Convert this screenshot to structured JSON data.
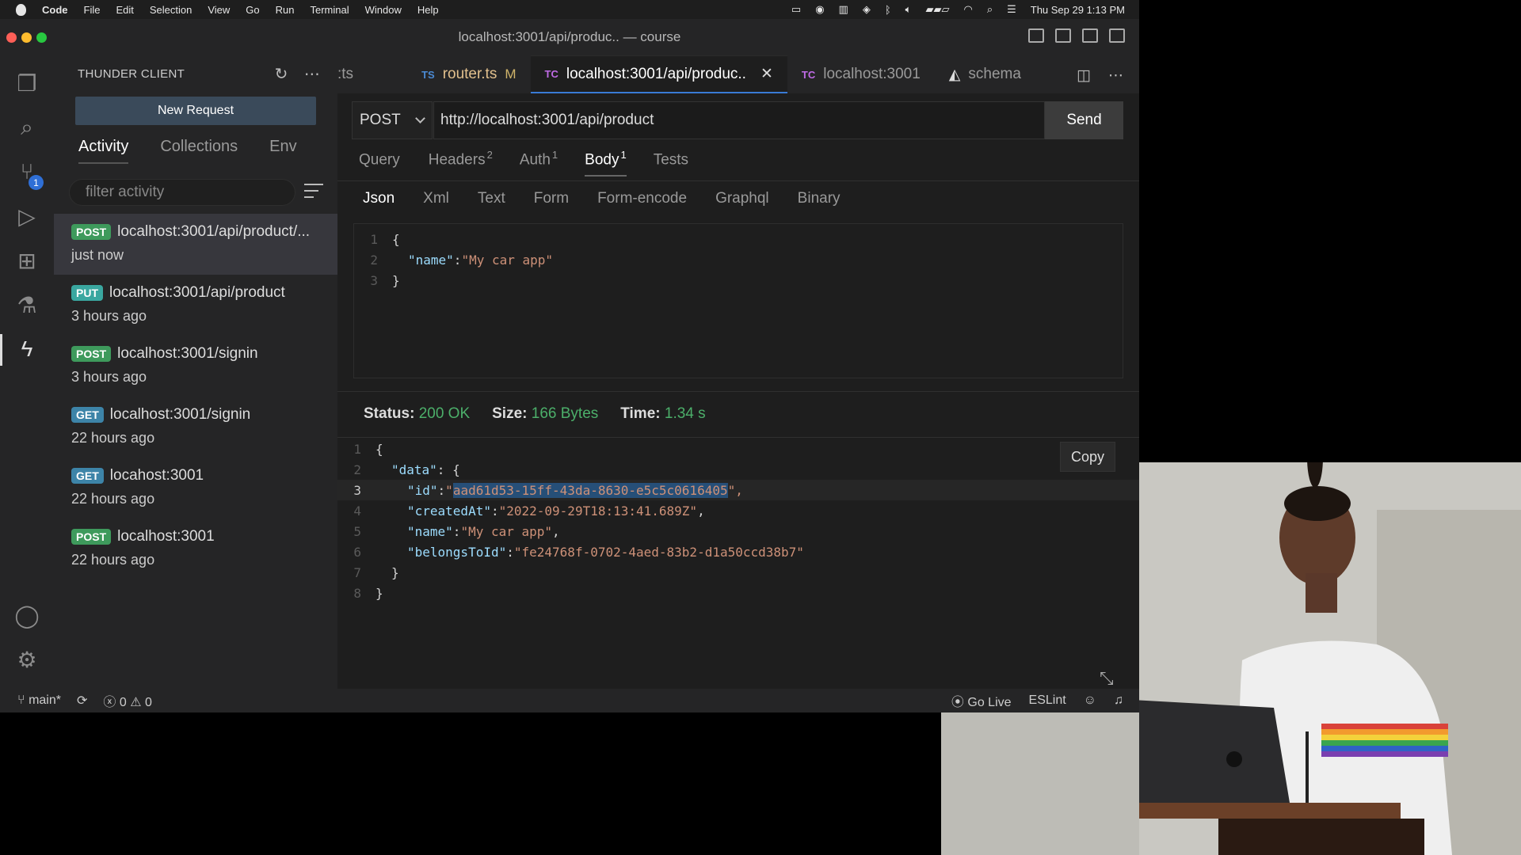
{
  "menubar": {
    "app": "Code",
    "items": [
      "File",
      "Edit",
      "Selection",
      "View",
      "Go",
      "Run",
      "Terminal",
      "Window",
      "Help"
    ],
    "clock": "Thu Sep 29  1:13 PM"
  },
  "window": {
    "title": "localhost:3001/api/produc.. — course"
  },
  "sidebar": {
    "header": "THUNDER CLIENT",
    "new_request": "New Request",
    "tabs": [
      "Activity",
      "Collections",
      "Env"
    ],
    "filter_placeholder": "filter activity",
    "activity": [
      {
        "method": "POST",
        "url": "localhost:3001/api/product/...",
        "time": "just now"
      },
      {
        "method": "PUT",
        "url": "localhost:3001/api/product",
        "time": "3 hours ago"
      },
      {
        "method": "POST",
        "url": "localhost:3001/signin",
        "time": "3 hours ago"
      },
      {
        "method": "GET",
        "url": "localhost:3001/signin",
        "time": "22 hours ago"
      },
      {
        "method": "GET",
        "url": "locahost:3001",
        "time": "22 hours ago"
      },
      {
        "method": "POST",
        "url": "localhost:3001",
        "time": "22 hours ago"
      }
    ]
  },
  "activitybar": {
    "scm_badge": "1"
  },
  "editor": {
    "tabs": [
      {
        "label": ":ts"
      },
      {
        "prefix": "TS",
        "label": "router.ts",
        "status": "M"
      },
      {
        "prefix": "TC",
        "label": "localhost:3001/api/produc.."
      },
      {
        "prefix": "TC",
        "label": "localhost:3001"
      },
      {
        "label": "schema"
      }
    ],
    "request": {
      "method": "POST",
      "url": "http://localhost:3001/api/product",
      "send": "Send",
      "tabs": [
        {
          "label": "Query",
          "count": ""
        },
        {
          "label": "Headers",
          "count": "2"
        },
        {
          "label": "Auth",
          "count": "1"
        },
        {
          "label": "Body",
          "count": "1"
        },
        {
          "label": "Tests",
          "count": ""
        }
      ],
      "body_tabs": [
        "Json",
        "Xml",
        "Text",
        "Form",
        "Form-encode",
        "Graphql",
        "Binary"
      ],
      "body": {
        "l1": "{",
        "key": "\"name\"",
        "colon": ": ",
        "value": "\"My car app\"",
        "l3": "}"
      }
    },
    "response": {
      "status_label": "Status:",
      "status": "200 OK",
      "size_label": "Size:",
      "size": "166 Bytes",
      "time_label": "Time:",
      "time": "1.34 s",
      "copy": "Copy",
      "lines": {
        "open": "{",
        "data_key": "\"data\"",
        "data_tail": ": {",
        "id_key": "\"id\"",
        "id_q": "\"",
        "id_val": "aad61d53-15ff-43da-8630-e5c5c0616405",
        "id_tail": "\",",
        "created_key": "\"createdAt\"",
        "created_val": "\"2022-09-29T18:13:41.689Z\"",
        "name_key": "\"name\"",
        "name_val": "\"My car app\"",
        "belongs_key": "\"belongsToId\"",
        "belongs_val": "\"fe24768f-0702-4aed-83b2-d1a50ccd38b7\"",
        "close_inner": "}",
        "close": "}",
        "sep": ": ",
        "comma": ","
      }
    }
  },
  "statusbar": {
    "branch": "main*",
    "errors": "0",
    "warnings": "0",
    "go_live": "Go Live",
    "eslint": "ESLint"
  }
}
